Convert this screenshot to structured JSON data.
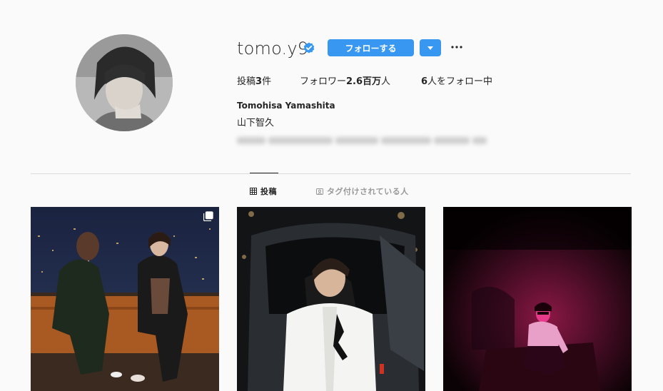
{
  "profile": {
    "username": "tomo.y9",
    "follow_label": "フォローする",
    "stats": {
      "posts_label": "投稿",
      "posts_count": "3",
      "posts_unit": "件",
      "followers_label": "フォロワー",
      "followers_count": "2.6百万",
      "followers_unit": "人",
      "following_count": "6",
      "following_label": "人をフォロー中"
    },
    "full_name": "Tomohisa Yamashita",
    "name_jp": "山下智久"
  },
  "tabs": [
    {
      "label": "投稿",
      "icon": "grid-icon",
      "active": true
    },
    {
      "label": "タグ付けされている人",
      "icon": "tagged-icon",
      "active": false
    }
  ],
  "colors": {
    "accent": "#3897f0",
    "verified": "#3897f0",
    "background": "#fafafa"
  }
}
